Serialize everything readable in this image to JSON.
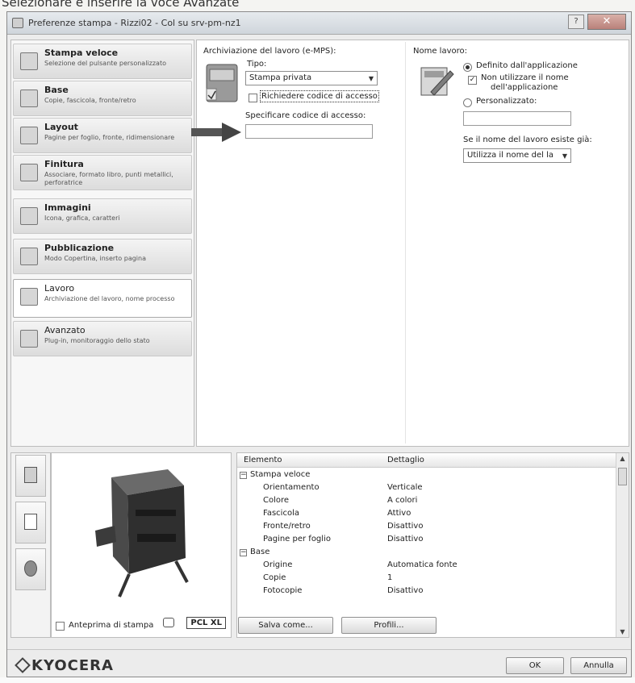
{
  "caption": "Selezionare e inserire la voce Avanzate",
  "window": {
    "title": "Preferenze stampa - Rizzi02 - Col su srv-pm-nz1",
    "help_label": "?",
    "close_label": "✕"
  },
  "nav": {
    "items": [
      {
        "title": "Stampa veloce",
        "desc": "Selezione del pulsante personalizzato",
        "icon": "quick-print-icon"
      },
      {
        "title": "Base",
        "desc": "Copie, fascicola, fronte/retro",
        "icon": "basic-icon"
      },
      {
        "title": "Layout",
        "desc": "Pagine per foglio, fronte, ridimensionare",
        "icon": "layout-icon"
      },
      {
        "title": "Finitura",
        "desc": "Associare, formato libro, punti metallici, perforatrice",
        "icon": "finishing-icon"
      },
      {
        "title": "Immagini",
        "desc": "Icona, grafica, caratteri",
        "icon": "imaging-icon"
      },
      {
        "title": "Pubblicazione",
        "desc": "Modo Copertina, inserto pagina",
        "icon": "publishing-icon"
      },
      {
        "title": "Lavoro",
        "desc": "Archiviazione del lavoro, nome processo",
        "icon": "job-icon"
      },
      {
        "title": "Avanzato",
        "desc": "Plug-in, monitoraggio dello stato",
        "icon": "advanced-icon"
      }
    ],
    "selected_index": 6
  },
  "job_storage": {
    "section_label": "Archiviazione del lavoro (e-MPS):",
    "type_label": "Tipo:",
    "type_value": "Stampa privata",
    "require_code_label": "Richiedere codice di accesso",
    "require_code_checked": false,
    "specify_code_label": "Specificare codice di accesso:",
    "specify_code_value": ""
  },
  "job_name": {
    "section_label": "Nome lavoro:",
    "option_app_label": "Definito dall'applicazione",
    "option_app_selected": true,
    "dont_use_label_line1": "Non utilizzare il nome",
    "dont_use_label_line2": "dell'applicazione",
    "dont_use_checked": true,
    "option_custom_label": "Personalizzato:",
    "custom_value": "",
    "if_exists_label": "Se il nome del lavoro esiste già:",
    "if_exists_value": "Utilizza il nome del la"
  },
  "details_grid": {
    "col_element": "Elemento",
    "col_detail": "Dettaglio",
    "rows": [
      {
        "group": true,
        "expander": "−",
        "name": "Stampa veloce",
        "value": ""
      },
      {
        "group": false,
        "name": "Orientamento",
        "value": "Verticale"
      },
      {
        "group": false,
        "name": "Colore",
        "value": "A colori"
      },
      {
        "group": false,
        "name": "Fascicola",
        "value": "Attivo"
      },
      {
        "group": false,
        "name": "Fronte/retro",
        "value": "Disattivo"
      },
      {
        "group": false,
        "name": "Pagine per foglio",
        "value": "Disattivo"
      },
      {
        "group": true,
        "expander": "−",
        "name": "Base",
        "value": ""
      },
      {
        "group": false,
        "name": "Origine",
        "value": "Automatica fonte"
      },
      {
        "group": false,
        "name": "Copie",
        "value": "1"
      },
      {
        "group": false,
        "name": "Fotocopie",
        "value": "Disattivo"
      }
    ]
  },
  "preview": {
    "pdl_badge": "PCL XL"
  },
  "bottom": {
    "print_preview_label": "Anteprima di stampa",
    "save_as_label": "Salva come...",
    "profiles_label": "Profili...",
    "logo_text": "KYOCERA",
    "ok_label": "OK",
    "cancel_label": "Annulla"
  }
}
